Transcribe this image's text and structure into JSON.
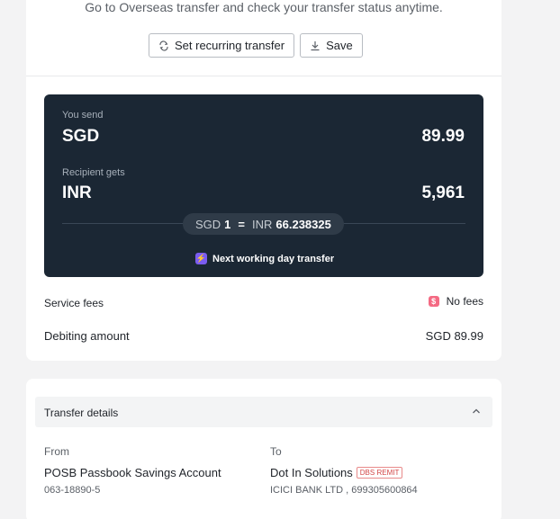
{
  "header": {
    "subtitle": "Go to Overseas transfer and check your transfer status anytime.",
    "recurring_label": "Set recurring transfer",
    "save_label": "Save"
  },
  "summary": {
    "send_label": "You send",
    "send_currency": "SGD",
    "send_amount": "89.99",
    "get_label": "Recipient gets",
    "get_currency": "INR",
    "get_amount": "5,961",
    "rate_from_currency": "SGD",
    "rate_from_value": "1",
    "rate_eq": "=",
    "rate_to_currency": "INR",
    "rate_to_value": "66.238325",
    "speed_label": "Next working day transfer"
  },
  "fees": {
    "service_label": "Service fees",
    "service_value": "No fees",
    "debit_label": "Debiting amount",
    "debit_value": "SGD 89.99"
  },
  "details": {
    "title": "Transfer details",
    "from_label": "From",
    "from_name": "POSB Passbook Savings Account",
    "from_number": "063-18890-5",
    "to_label": "To",
    "to_name": "Dot In Solutions",
    "to_tag": "DBS REMIT",
    "to_bank": "ICICI BANK LTD , 699305600864"
  },
  "colors": {
    "panel": "#1b2734",
    "accent": "#7b5cf0",
    "fee_badge": "#f46a83"
  }
}
